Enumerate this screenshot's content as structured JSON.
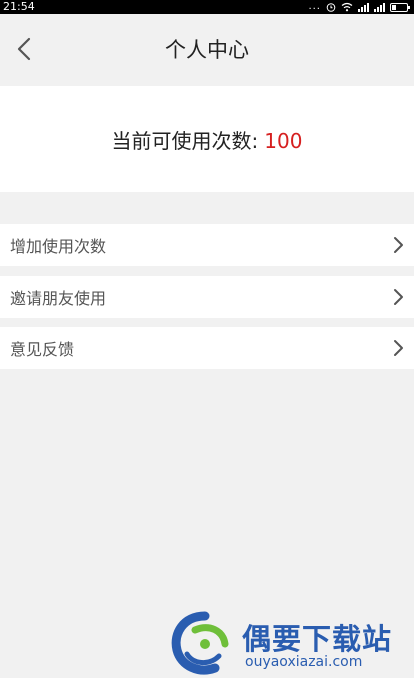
{
  "status_bar": {
    "time": "21:54",
    "dots": "...",
    "battery_level": 0.25
  },
  "header": {
    "title": "个人中心",
    "back_icon": "chevron-left-icon"
  },
  "usage": {
    "label": "当前可使用次数:",
    "value": "100",
    "value_color": "#d62020"
  },
  "menu": {
    "items": [
      {
        "label": "增加使用次数",
        "icon": "chevron-right-icon"
      },
      {
        "label": "邀请朋友使用",
        "icon": "chevron-right-icon"
      },
      {
        "label": "意见反馈",
        "icon": "chevron-right-icon"
      }
    ]
  },
  "watermark": {
    "title": "偶要下载站",
    "url": "ouyaoxiazai.com",
    "color": "#2a5db0"
  }
}
